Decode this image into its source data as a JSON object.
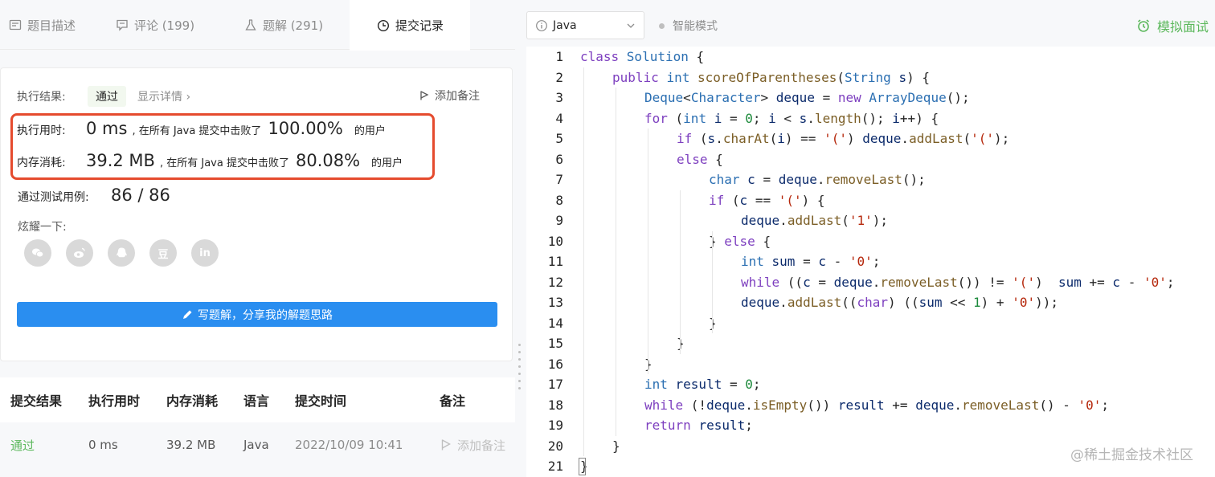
{
  "tabs": [
    {
      "label": "题目描述",
      "icon": "description-icon"
    },
    {
      "label": "评论 (199)",
      "icon": "comment-icon"
    },
    {
      "label": "题解 (291)",
      "icon": "flask-icon"
    },
    {
      "label": "提交记录",
      "icon": "clock-icon",
      "active": true
    }
  ],
  "result": {
    "label": "执行结果:",
    "status": "通过",
    "detail_link": "显示详情 ›",
    "add_note": "添加备注"
  },
  "runtime": {
    "label": "执行用时:",
    "value": "0 ms",
    "middle": ", 在所有 Java 提交中击败了",
    "percent": "100.00%",
    "tail": "的用户"
  },
  "memory": {
    "label": "内存消耗:",
    "value": "39.2 MB",
    "middle": ", 在所有 Java 提交中击败了",
    "percent": "80.08%",
    "tail": "的用户"
  },
  "tests": {
    "label": "通过测试用例:",
    "value": "86 / 86"
  },
  "share": {
    "label": "炫耀一下:",
    "icons": [
      "wechat-icon",
      "weibo-icon",
      "qq-icon",
      "douban-icon",
      "linkedin-icon"
    ],
    "douban_text": "豆",
    "linkedin_text": "in"
  },
  "write_solution": "写题解，分享我的解题思路",
  "submissions": {
    "headers": [
      "提交结果",
      "执行用时",
      "内存消耗",
      "语言",
      "提交时间",
      "备注"
    ],
    "rows": [
      {
        "result": "通过",
        "runtime": "0 ms",
        "memory": "39.2 MB",
        "language": "Java",
        "time": "2022/10/09 10:41",
        "note": "添加备注"
      }
    ]
  },
  "editor": {
    "language": "Java",
    "smart_mode": "智能模式",
    "mock_label": "模拟面试",
    "line_numbers": [
      "1",
      "2",
      "3",
      "4",
      "5",
      "6",
      "7",
      "8",
      "9",
      "10",
      "11",
      "12",
      "13",
      "14",
      "15",
      "16",
      "17",
      "18",
      "19",
      "20",
      "21"
    ]
  },
  "watermark": "@稀土掘金技术社区",
  "colors": {
    "accent": "#2a8ef0",
    "success": "#5cb85c",
    "highlight": "#e54b2e"
  }
}
